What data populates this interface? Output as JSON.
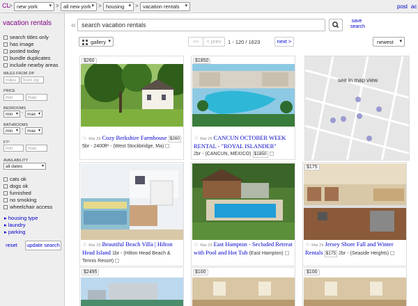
{
  "header": {
    "logo": "CL",
    "location": "new york",
    "area": "all new york",
    "section": "housing",
    "category": "vacation rentals",
    "post_label": "post",
    "account_label": "ac"
  },
  "sidebar": {
    "title": "vacation rentals",
    "filters": [
      "search titles only",
      "has image",
      "posted today",
      "bundle duplicates",
      "include nearby areas"
    ],
    "miles_label": "MILES FROM ZIP",
    "miles_placeholder": "miles",
    "zip_placeholder": "from zip",
    "price_label": "PRICE",
    "price_min": "min",
    "price_max": "max",
    "bedrooms_label": "BEDROOMS",
    "bedrooms_min": "min",
    "bedrooms_max": "max",
    "bathrooms_label": "BATHROOMS",
    "bathrooms_min": "min",
    "bathrooms_max": "max",
    "ft_label": "FT²",
    "ft_min": "min",
    "ft_max": "max",
    "availability_label": "AVAILABILITY",
    "availability_value": "all dates",
    "pet_filters": [
      "cats ok",
      "dogs ok",
      "furnished",
      "no smoking",
      "wheelchair access"
    ],
    "links": [
      "housing type",
      "laundry",
      "parking"
    ],
    "reset_label": "reset",
    "update_label": "update search"
  },
  "search": {
    "placeholder": "search vacation rentals",
    "save_label_1": "save",
    "save_label_2": "search"
  },
  "toolbar": {
    "view": "gallery",
    "first": "<<",
    "prev": "< prev",
    "range": "1 - 120 / 1623",
    "next": "next >",
    "sort": "newest"
  },
  "map": {
    "label": "see in map view"
  },
  "listings": [
    {
      "price": "$260",
      "date": "Mar 29",
      "title": "Cozy Berkshire Farmhouse",
      "badge": "$260",
      "meta": "5br - 2400ft² - (West Stockbridge, Ma)"
    },
    {
      "price": "$1850",
      "date": "Mar 29",
      "title": "CANCUN OCTOBER WEEK RENTAL - \"ROYAL ISLANDER\"",
      "badge": "$1850",
      "meta": "2br - (CANCUN, MEXICO)"
    },
    {
      "price": "",
      "date": "Mar 29",
      "title": "Beautiful Beach Villa | Hilton Head Island",
      "badge": "",
      "meta": "1br - (Hilton Head Beach & Tennis Resort)"
    },
    {
      "price": "",
      "date": "Mar 29",
      "title": "East Hampton - Secluded Retreat with Pool and Hot Tub",
      "badge": "",
      "meta": "(East Hampton)"
    },
    {
      "price": "$175",
      "date": "Mar 29",
      "title": "Jersey Shore Fall and Winter Rentals",
      "badge": "$175",
      "meta": "2br - (Seaside Heights)"
    },
    {
      "price": "$2495",
      "date": "",
      "title": "",
      "badge": "",
      "meta": ""
    },
    {
      "price": "$100",
      "date": "",
      "title": "",
      "badge": "",
      "meta": ""
    },
    {
      "price": "$100",
      "date": "",
      "title": "",
      "badge": "",
      "meta": ""
    }
  ],
  "colors": {
    "link": "#0000cc",
    "visited": "#800080",
    "panel": "#eeeeee"
  }
}
